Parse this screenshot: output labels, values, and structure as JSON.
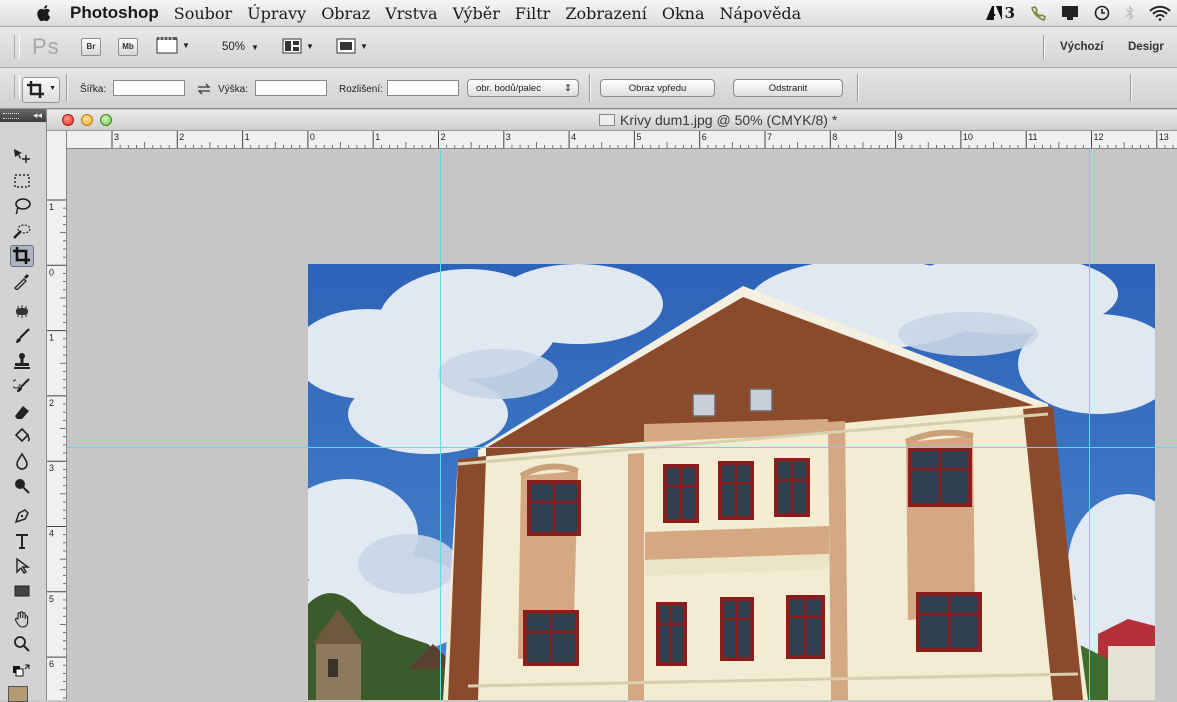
{
  "menubar": {
    "app_name": "Photoshop",
    "items": [
      "Soubor",
      "Úpravy",
      "Obraz",
      "Vrstva",
      "Výběr",
      "Filtr",
      "Zobrazení",
      "Okna",
      "Nápověda"
    ],
    "adobe_badge": "3"
  },
  "appbar": {
    "logo": "Ps",
    "bridge_label": "Br",
    "minibridge_label": "Mb",
    "zoom_value": "50%",
    "workspace_default": "Výchozí",
    "workspace_design": "Desigr"
  },
  "options": {
    "width_label": "Šířka:",
    "width_value": "",
    "height_label": "Výška:",
    "height_value": "",
    "resolution_label": "Rozlišení:",
    "resolution_value": "",
    "unit_select": "obr. bodů/palec",
    "front_image_button": "Obraz vpředu",
    "clear_button": "Odstranit"
  },
  "document": {
    "title": "Krivy dum1.jpg @ 50% (CMYK/8) *"
  },
  "rulers": {
    "horizontal_ticks": [
      "3",
      "2",
      "1",
      "0",
      "1",
      "2",
      "3",
      "4",
      "5",
      "6",
      "7",
      "8",
      "9",
      "10",
      "11",
      "12",
      "13"
    ],
    "vertical_ticks": [
      "1",
      "0",
      "1",
      "2",
      "3",
      "4",
      "5",
      "6"
    ]
  },
  "tools": {
    "active": "crop-tool",
    "foreground_color": "#b39b73",
    "items": [
      "move-tool",
      "marquee-tool",
      "lasso-tool",
      "quick-selection-tool",
      "crop-tool",
      "eyedropper-tool",
      "spot-healing-tool",
      "brush-tool",
      "clone-stamp-tool",
      "history-brush-tool",
      "eraser-tool",
      "paint-bucket-tool",
      "blur-tool",
      "dodge-tool",
      "pen-tool",
      "type-tool",
      "path-selection-tool",
      "rectangle-tool",
      "hand-tool",
      "zoom-tool"
    ]
  },
  "colors": {
    "guide": "#4fe3e9",
    "canvas_bg": "#c6c6c6",
    "facade_brown": "#8b4a2b",
    "facade_cream": "#f2ecd2",
    "facade_tan": "#d4a882"
  }
}
